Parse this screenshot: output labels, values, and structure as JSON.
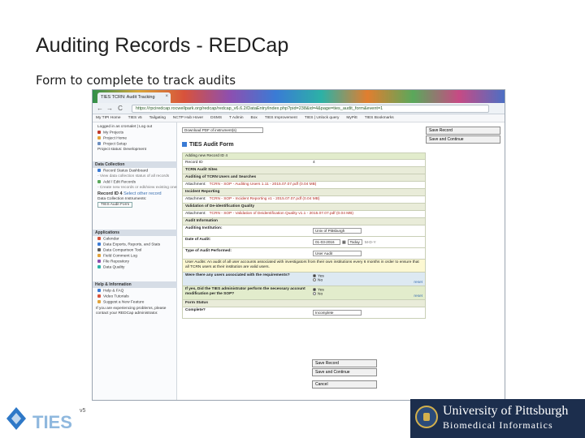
{
  "slide": {
    "title": "Auditing Records - REDCap",
    "subtitle": "Form to complete to track audits"
  },
  "browser": {
    "tab_title": "TIES TCRN: Audit Tracking",
    "tab_close": "×",
    "back": "←",
    "forward": "→",
    "reload": "C",
    "url": "https://rpciredcap.rocwellpark.org/redcap/redcap_v6.6.2/DataEntry/index.php?pid=238&id=4&page=ties_audit_form&event=1",
    "bookmarks": [
      "My TIPI Home",
      "TIES v5",
      "Tailgating",
      "NCTP Hub Hover",
      "DSMS",
      "T Admin",
      "Box",
      "TIES Improvement",
      "TIES | Unlock query",
      "MyPitt",
      "TIES Bookmarks"
    ]
  },
  "sidebar": {
    "logged_in": "Logged in as cromalet | Log out",
    "top_links": [
      "My Projects",
      "Project Home",
      "Project Setup"
    ],
    "project_status": "Project status: Development",
    "data_collection_header": "Data Collection",
    "dc_links": [
      "Record Status Dashboard",
      "- View data collection status of all records",
      "Add / Edit Records",
      "- Create new records or edit/view existing ones"
    ],
    "record_label": "Record ID 4",
    "select_other": "Select other record",
    "instruments_label": "Data Collection Instruments:",
    "instrument": "TIES Audit Form",
    "applications_header": "Applications",
    "apps": [
      "Calendar",
      "Data Exports, Reports, and Stats",
      "Data Comparison Tool",
      "Field Comment Log",
      "File Repository",
      "Data Quality"
    ],
    "help_header": "Help & Information",
    "help_links": [
      "Help & FAQ",
      "Video Tutorials",
      "Suggest a New Feature"
    ],
    "help_note": "If you are experiencing problems, please contact your REDCap administrator."
  },
  "main": {
    "actions": [
      "Save Record",
      "Save and Continue"
    ],
    "pdf_select": "Download PDF of instrument(s)",
    "form_title": "TIES Audit Form",
    "rows": [
      {
        "label": "Adding new Record ID 4",
        "value": "",
        "style": "green"
      },
      {
        "label": "Record ID",
        "value": "4",
        "style": "plain"
      },
      {
        "label": "TCRN Audit Sites",
        "value": "",
        "style": "hdr"
      },
      {
        "label": "Auditing of TCRN Users and Searches",
        "value": "",
        "style": "hdr"
      },
      {
        "label": "Attachment:",
        "value": "TCRN - SOP - Auditing Users 1.11 - 2015.07.07.pdf (0.04 MB)",
        "style": "attach"
      },
      {
        "label": "Incident Reporting",
        "value": "",
        "style": "hdr"
      },
      {
        "label": "Attachment:",
        "value": "TCRN - SOP - Incident Reporting v1 - 2015.07.07.pdf (0.04 MB)",
        "style": "attach"
      },
      {
        "label": "Validation of De-identification Quality",
        "value": "",
        "style": "hdr"
      },
      {
        "label": "Attachment:",
        "value": "TCRN - SOP - Validation of Deidentification Quality v1.1 - 2015.07.07.pdf (0.04 MB)",
        "style": "attach"
      },
      {
        "label": "Audit Information",
        "value": "",
        "style": "hdr"
      },
      {
        "label": "Auditing Institution:",
        "value": "Univ of Pittsburgh",
        "style": "select"
      },
      {
        "label": "Date of Audit:",
        "value": "01-03-2016",
        "style": "date"
      },
      {
        "label": "Type of Audit Performed:",
        "value": "User Audit",
        "style": "select"
      },
      {
        "label": "User Audits: An audit of all user accounts associated with investigators from their own institutions every 6 months in order to ensure that all TCRN users at their institution are valid users.",
        "value": "",
        "style": "yellow"
      },
      {
        "label": "Were there any users associated with the requirements?",
        "value": "",
        "style": "radio1"
      },
      {
        "label": "If yes, Did the TIES administrator perform the necessary account modification per the SOP?",
        "value": "",
        "style": "radio2"
      },
      {
        "label": "Form Status",
        "value": "",
        "style": "hdr"
      },
      {
        "label": "Complete?",
        "value": "Incomplete",
        "style": "select"
      }
    ],
    "today_label": "Today",
    "date_format": "M-D-Y",
    "yes": "Yes",
    "no": "No",
    "reset": "reset",
    "bottom_buttons": [
      "Save Record",
      "Save and Continue",
      "Cancel"
    ]
  },
  "footer": {
    "pitt_name": "University of Pittsburgh",
    "pitt_dept": "Biomedical Informatics",
    "ties_logo_text": "TIES",
    "ties_version": "v5"
  }
}
